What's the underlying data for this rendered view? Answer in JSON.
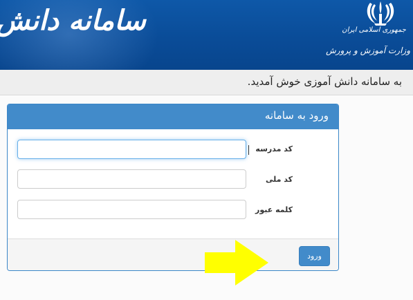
{
  "header": {
    "calligraphy": "سامانه دانش",
    "gov_line1": "جمهوری اسلامی ایران",
    "gov_line2": "",
    "gov_line3": "وزارت آموزش و پرورش",
    "emblem_icon": "iran-emblem-icon",
    "background_color": "#0a4c98"
  },
  "welcome": {
    "text": "به سامانه دانش آموزی خوش آمدید."
  },
  "login_panel": {
    "title": "ورود به سامانه",
    "accent_color": "#428bca",
    "fields": [
      {
        "label": "کد مدرسه",
        "value": "",
        "focused": true
      },
      {
        "label": "کد ملی",
        "value": ""
      },
      {
        "label": "کلمه عبور",
        "value": ""
      }
    ],
    "submit_label": "ورود"
  },
  "annotation": {
    "arrow_icon": "pointer-arrow-icon",
    "arrow_color": "#ffff00"
  }
}
